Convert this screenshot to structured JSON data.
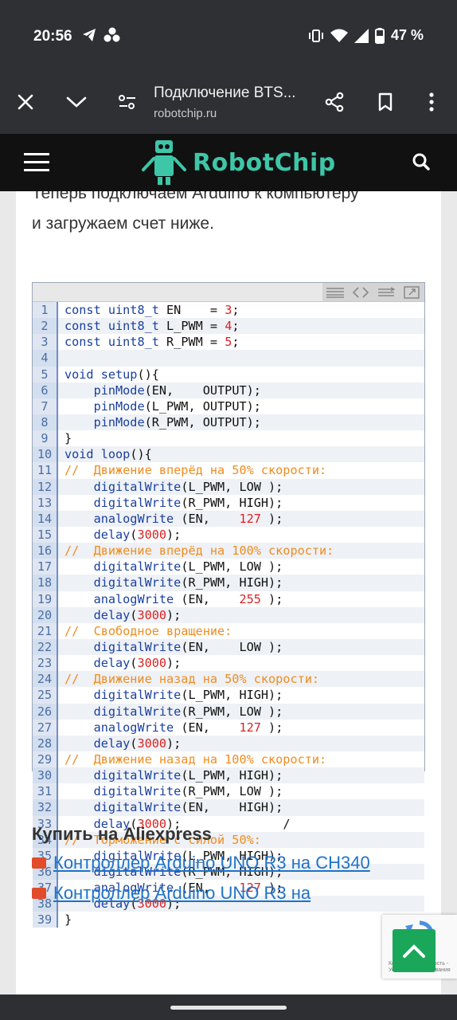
{
  "status_bar": {
    "time": "20:56",
    "battery": "47 %",
    "icons_left": [
      "telegram-icon",
      "app-cluster-icon"
    ],
    "icons_right": [
      "vibrate-icon",
      "wifi-icon",
      "signal-icon",
      "battery-icon"
    ]
  },
  "toolbar": {
    "title": "Подключение BTS...",
    "url": "robotchip.ru"
  },
  "site": {
    "logo_text": "RobotChip",
    "brand_color": "#3ec6a8"
  },
  "article": {
    "intro_line1": "Теперь подключаем Arduino к компьютеру",
    "intro_line2": "и загружаем счет ниже."
  },
  "code": {
    "lines": [
      {
        "n": "1",
        "text": "const uint8_t EN    = 3;"
      },
      {
        "n": "2",
        "text": "const uint8_t L_PWM = 4;"
      },
      {
        "n": "3",
        "text": "const uint8_t R_PWM = 5;"
      },
      {
        "n": "4",
        "text": ""
      },
      {
        "n": "5",
        "text": "void setup(){"
      },
      {
        "n": "6",
        "text": "    pinMode(EN,    OUTPUT);"
      },
      {
        "n": "7",
        "text": "    pinMode(L_PWM, OUTPUT);"
      },
      {
        "n": "8",
        "text": "    pinMode(R_PWM, OUTPUT);"
      },
      {
        "n": "9",
        "text": "}"
      },
      {
        "n": "10",
        "text": "void loop(){"
      },
      {
        "n": "11",
        "text": "//  Движение вперёд на 50% скорости:"
      },
      {
        "n": "12",
        "text": "    digitalWrite(L_PWM, LOW );"
      },
      {
        "n": "13",
        "text": "    digitalWrite(R_PWM, HIGH);"
      },
      {
        "n": "14",
        "text": "    analogWrite (EN,    127 );"
      },
      {
        "n": "15",
        "text": "    delay(3000);"
      },
      {
        "n": "16",
        "text": "//  Движение вперёд на 100% скорости:"
      },
      {
        "n": "17",
        "text": "    digitalWrite(L_PWM, LOW );"
      },
      {
        "n": "18",
        "text": "    digitalWrite(R_PWM, HIGH);"
      },
      {
        "n": "19",
        "text": "    analogWrite (EN,    255 );"
      },
      {
        "n": "20",
        "text": "    delay(3000);"
      },
      {
        "n": "21",
        "text": "//  Свободное вращение:"
      },
      {
        "n": "22",
        "text": "    digitalWrite(EN,    LOW );"
      },
      {
        "n": "23",
        "text": "    delay(3000);"
      },
      {
        "n": "24",
        "text": "//  Движение назад на 50% скорости:"
      },
      {
        "n": "25",
        "text": "    digitalWrite(L_PWM, HIGH);"
      },
      {
        "n": "26",
        "text": "    digitalWrite(R_PWM, LOW );"
      },
      {
        "n": "27",
        "text": "    analogWrite (EN,    127 );"
      },
      {
        "n": "28",
        "text": "    delay(3000);"
      },
      {
        "n": "29",
        "text": "//  Движение назад на 100% скорости:"
      },
      {
        "n": "30",
        "text": "    digitalWrite(L_PWM, HIGH);"
      },
      {
        "n": "31",
        "text": "    digitalWrite(R_PWM, LOW );"
      },
      {
        "n": "32",
        "text": "    digitalWrite(EN,    HIGH);"
      },
      {
        "n": "33",
        "text": "    delay(3000);              /"
      },
      {
        "n": "34",
        "text": "//  Торможение с силой 50%:"
      },
      {
        "n": "35",
        "text": "    digitalWrite(L_PWM, HIGH);"
      },
      {
        "n": "36",
        "text": "    digitalWrite(R_PWM, HIGH);"
      },
      {
        "n": "37",
        "text": "    analogWrite (EN,    127 );"
      },
      {
        "n": "38",
        "text": "    delay(3000);"
      },
      {
        "n": "39",
        "text": "}"
      }
    ]
  },
  "buy": {
    "title": "Купить на Aliexpress",
    "links": [
      "Контроллер Arduino UNO R3 на CH340",
      "Контроллер Arduino UNO R3 на"
    ]
  },
  "recaptcha": {
    "text": "Конфиденциальность - Условия использования"
  }
}
